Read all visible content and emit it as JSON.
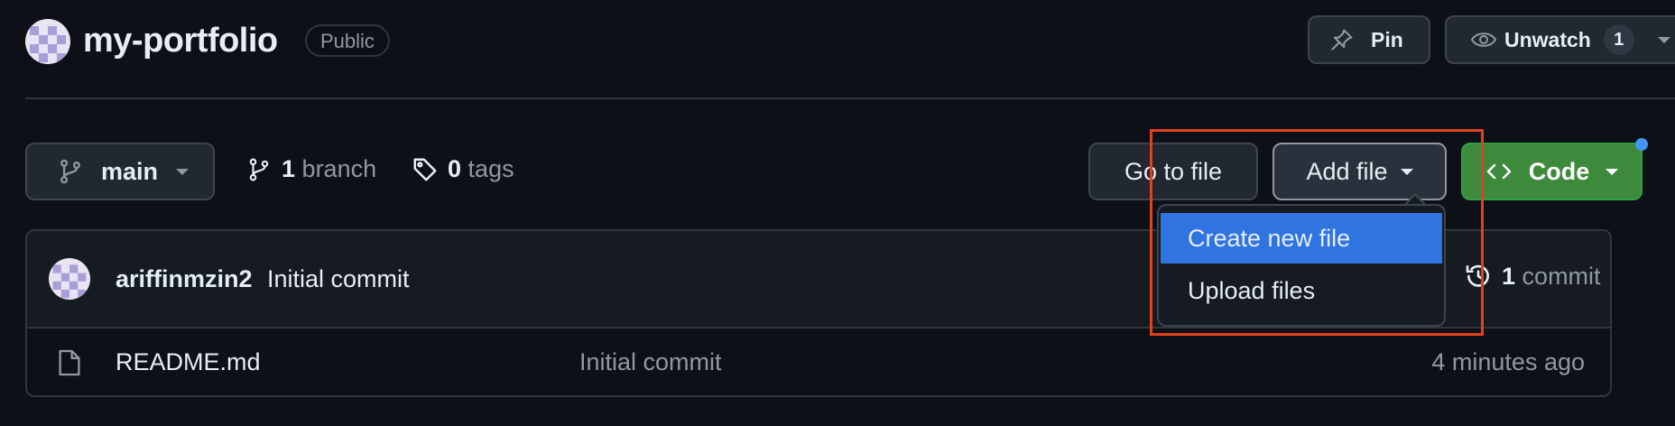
{
  "repo": {
    "name": "my-portfolio",
    "visibility": "Public",
    "pin_label": "Pin",
    "unwatch_label": "Unwatch",
    "watch_count": "1"
  },
  "toolbar": {
    "branch_name": "main",
    "branch_count": "1",
    "branch_label": "branch",
    "tag_count": "0",
    "tag_label": "tags",
    "goto_file_label": "Go to file",
    "add_file_label": "Add file",
    "code_label": "Code"
  },
  "add_file_menu": {
    "items": [
      {
        "label": "Create new file",
        "active": true
      },
      {
        "label": "Upload files",
        "active": false
      }
    ]
  },
  "latest_commit": {
    "author": "ariffinmzin2",
    "message": "Initial commit",
    "commit_count": "1",
    "commit_label": "commit"
  },
  "files": [
    {
      "name": "README.md",
      "commit_message": "Initial commit",
      "age": "4 minutes ago",
      "icon": "file-icon"
    }
  ],
  "colors": {
    "background": "#0d1117",
    "code_button": "#3e8a3c",
    "menu_active": "#2f74e0",
    "highlight_box": "#e2401e",
    "notification_dot": "#4493f8"
  }
}
